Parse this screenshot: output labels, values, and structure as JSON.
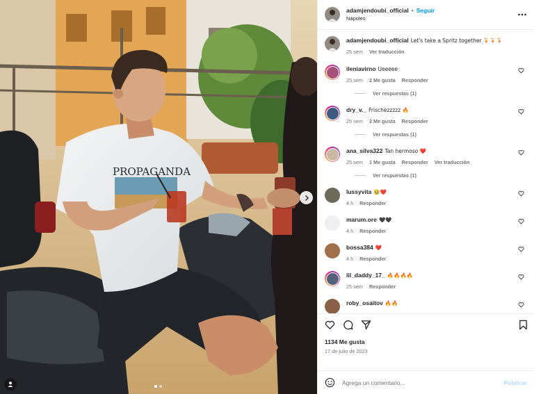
{
  "post": {
    "author": "adamjendoubi_official",
    "follow_label": "Seguir",
    "location": "Nápoles",
    "caption": "Let's take a Spritz together 🍹🍹🍹",
    "caption_time": "25 sem",
    "caption_translate": "Ver traducción",
    "photo_text": "PROPAGANDA"
  },
  "comments": [
    {
      "user": "ileniavirno",
      "text": "Ueeeee",
      "time": "25 sem",
      "likes": "2 Me gusta",
      "reply": "Responder",
      "translate": "",
      "replies": "Ver respuestas (1)",
      "avatar_color": "#a8527a",
      "ring": true
    },
    {
      "user": "dry_v._",
      "text": "Frischezzzzz 🔥",
      "time": "25 sem",
      "likes": "2 Me gusta",
      "reply": "Responder",
      "translate": "",
      "replies": "Ver respuestas (1)",
      "avatar_color": "#3d5a80",
      "ring": true
    },
    {
      "user": "ana_silva322",
      "text": "Tan hermoso ❤️",
      "time": "25 sem",
      "likes": "1 Me gusta",
      "reply": "Responder",
      "translate": "Ver traducción",
      "replies": "Ver respuestas (1)",
      "avatar_color": "#c9b8a6",
      "ring": true
    },
    {
      "user": "lussyvita",
      "text": "🥹❤️",
      "time": "4 h",
      "likes": "",
      "reply": "Responder",
      "translate": "",
      "replies": "",
      "avatar_color": "#6e6a5a",
      "ring": false
    },
    {
      "user": "marum.ore",
      "text": "🖤🖤",
      "time": "4 h",
      "likes": "",
      "reply": "Responder",
      "translate": "",
      "replies": "",
      "avatar_color": "#efefef",
      "ring": false
    },
    {
      "user": "bossa384",
      "text": "❤️",
      "time": "4 h",
      "likes": "",
      "reply": "Responder",
      "translate": "",
      "replies": "",
      "avatar_color": "#a0704a",
      "ring": false
    },
    {
      "user": "lil_daddy_17_",
      "text": "🔥🔥🔥🔥",
      "time": "25 sem",
      "likes": "",
      "reply": "Responder",
      "translate": "",
      "replies": "",
      "avatar_color": "#55607a",
      "ring": true
    },
    {
      "user": "roby_osaitov",
      "text": "🔥🔥",
      "time": "",
      "likes": "",
      "reply": "",
      "translate": "",
      "replies": "",
      "avatar_color": "#8a6048",
      "ring": false
    }
  ],
  "footer": {
    "likes": "1134 Me gusta",
    "date": "17 de julio de 2023",
    "comment_placeholder": "Agrega un comentario...",
    "post_label": "Publicar"
  },
  "colors": {
    "follow": "#0095f6",
    "heart": "#e0245e",
    "fire": "#f2811d"
  }
}
